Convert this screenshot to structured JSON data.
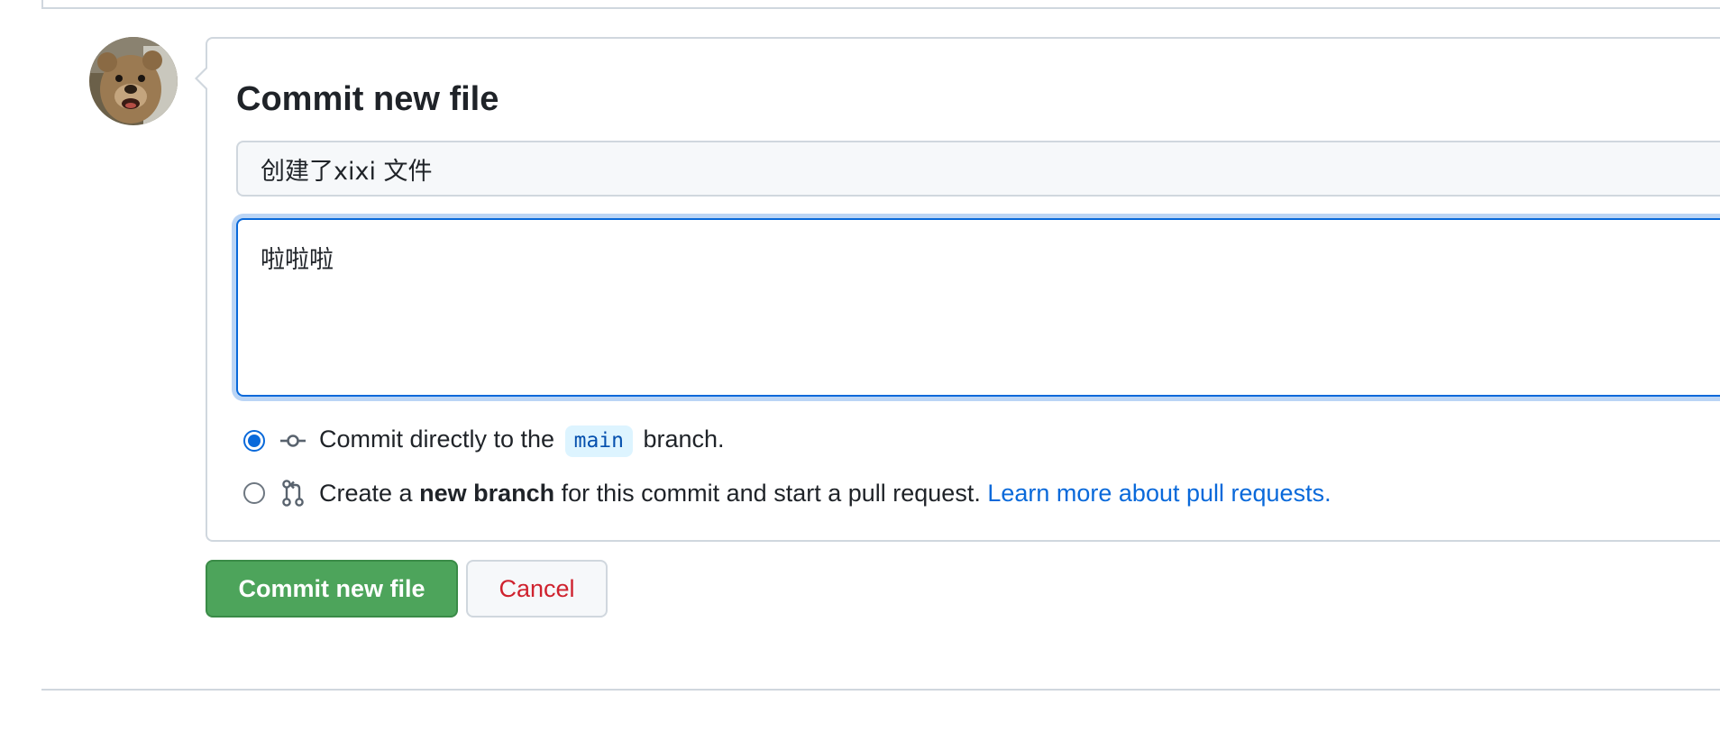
{
  "commit": {
    "title": "Commit new file",
    "summary_value": "创建了xixi 文件",
    "description_value": "啦啦啦",
    "options": {
      "direct": {
        "checked": true,
        "prefix": "Commit directly to the",
        "branch_name": "main",
        "suffix": "branch."
      },
      "new_branch": {
        "checked": false,
        "prefix": "Create a",
        "bold": "new branch",
        "middle": "for this commit and start a pull request.",
        "link": "Learn more about pull requests."
      }
    }
  },
  "buttons": {
    "commit_label": "Commit new file",
    "cancel_label": "Cancel"
  },
  "icons": {
    "commit": "git-commit-icon",
    "pull_request": "git-pull-request-icon",
    "avatar": "user-avatar"
  },
  "colors": {
    "primary_button": "#4da45b",
    "cancel_text": "#cf222e",
    "link": "#0969da",
    "focus_border": "#0969da",
    "branch_pill_bg": "#ddf4ff"
  }
}
